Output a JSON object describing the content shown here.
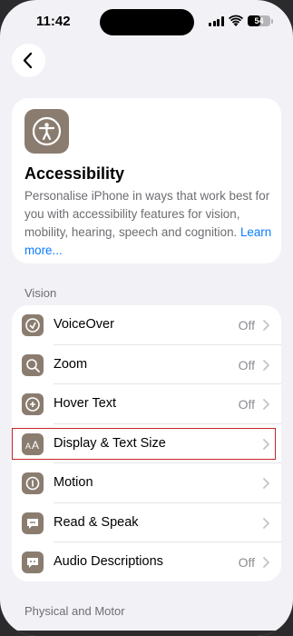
{
  "status_bar": {
    "time": "11:42",
    "battery_level": "54"
  },
  "header": {
    "title": "Accessibility",
    "description": "Personalise iPhone in ways that work best for you with accessibility features for vision, mobility, hearing, speech and cognition.",
    "learn_more": "Learn more..."
  },
  "sections": {
    "vision": "Vision",
    "physical": "Physical and Motor"
  },
  "vision_items": [
    {
      "label": "VoiceOver",
      "value": "Off",
      "icon": "voiceover-icon"
    },
    {
      "label": "Zoom",
      "value": "Off",
      "icon": "zoom-icon"
    },
    {
      "label": "Hover Text",
      "value": "Off",
      "icon": "hover-text-icon"
    },
    {
      "label": "Display & Text Size",
      "value": "",
      "icon": "text-size-icon"
    },
    {
      "label": "Motion",
      "value": "",
      "icon": "motion-icon"
    },
    {
      "label": "Read & Speak",
      "value": "",
      "icon": "speech-bubble-icon"
    },
    {
      "label": "Audio Descriptions",
      "value": "Off",
      "icon": "audio-description-icon"
    }
  ],
  "colors": {
    "accent": "#0a7cff",
    "icon_bg": "#8a7d70",
    "highlight": "#c3262b",
    "background": "#f2f1f6"
  }
}
